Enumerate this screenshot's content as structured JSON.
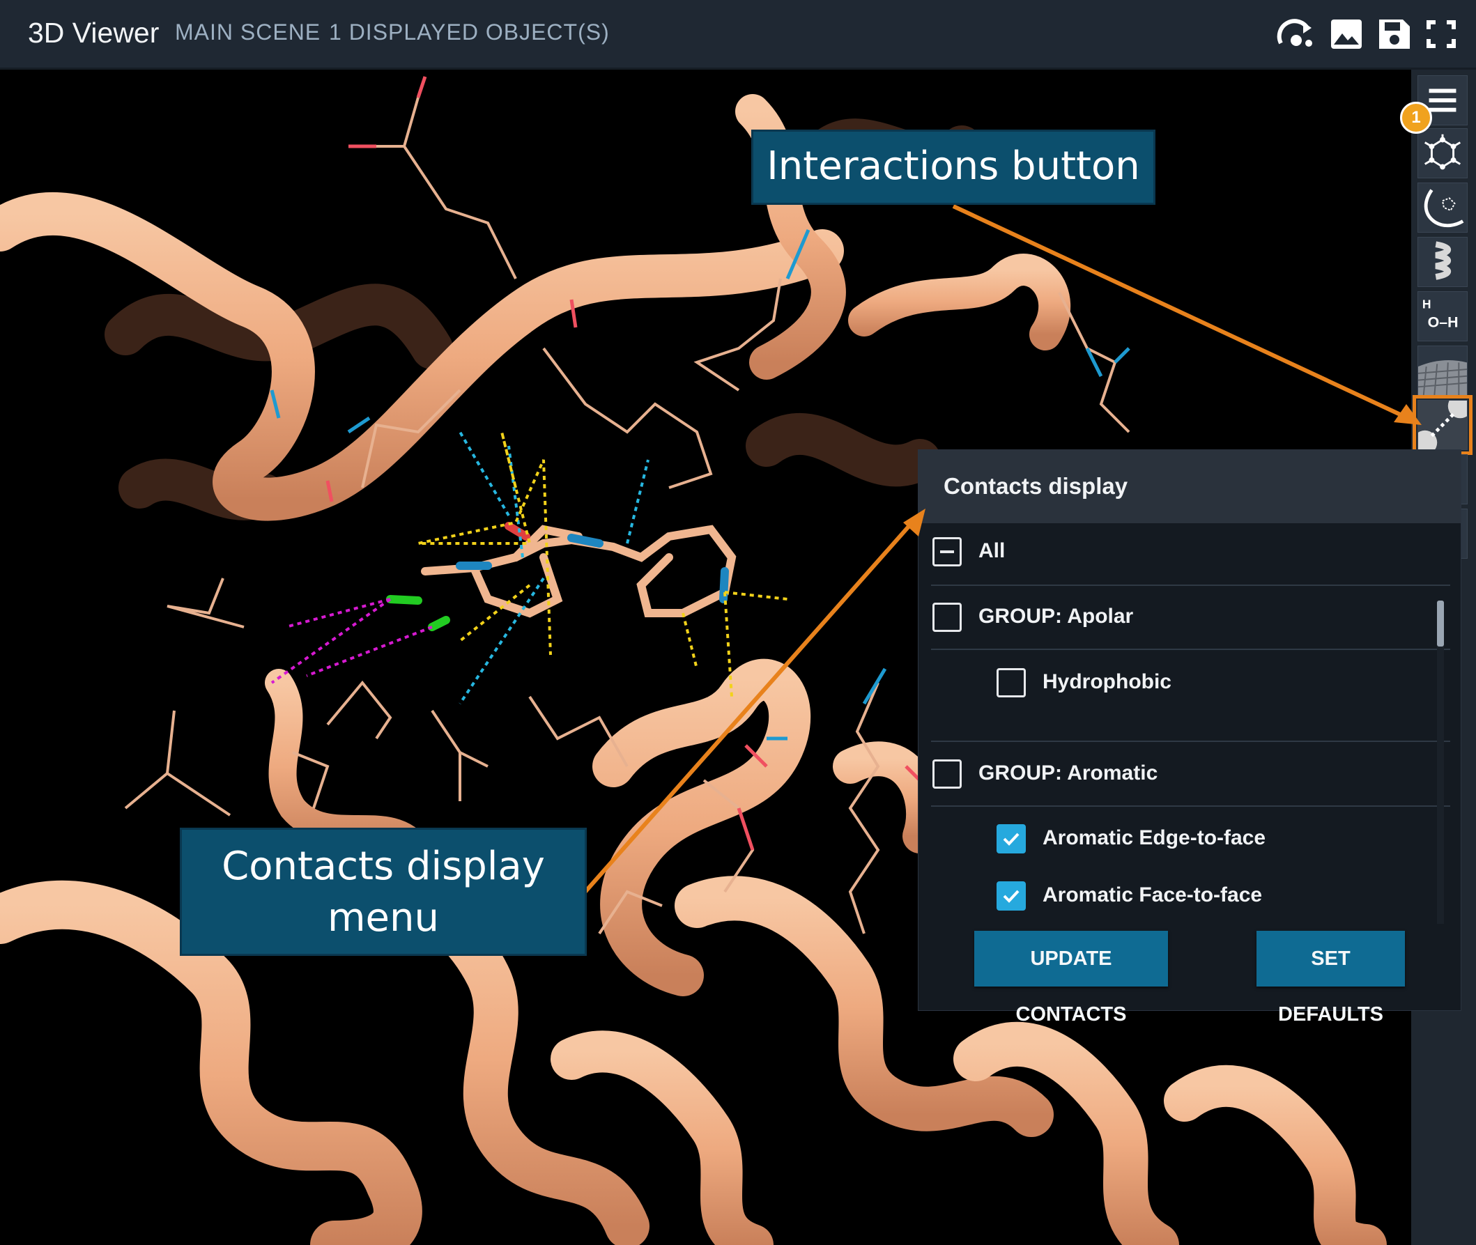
{
  "header": {
    "title": "3D Viewer",
    "scene": "MAIN SCENE",
    "objects": "1 DISPLAYED OBJECT(S)",
    "buttons": [
      {
        "icon": "orbit-icon"
      },
      {
        "icon": "image-icon"
      },
      {
        "icon": "save-icon"
      },
      {
        "icon": "fullscreen-icon"
      }
    ]
  },
  "toolbar": {
    "badge": "1",
    "buttons": [
      {
        "icon": "menu-icon"
      },
      {
        "icon": "molecule-icon"
      },
      {
        "icon": "ligand-pocket-icon"
      },
      {
        "icon": "helix-icon"
      },
      {
        "icon": "hydrogen-icon",
        "text_h": "H",
        "text_oh": "O–H"
      },
      {
        "icon": "surface-icon"
      },
      {
        "icon": "interactions-icon",
        "active": true
      },
      {
        "icon": "settings-icon"
      },
      {
        "icon": "target-icon"
      }
    ]
  },
  "contacts_panel": {
    "title": "Contacts display",
    "options": [
      {
        "label": "All",
        "state": "indeterminate"
      },
      {
        "label": "GROUP: Apolar",
        "state": "unchecked"
      },
      {
        "label": "Hydrophobic",
        "state": "unchecked"
      },
      {
        "label": "GROUP: Aromatic",
        "state": "unchecked"
      },
      {
        "label": "Aromatic Edge-to-face",
        "state": "checked"
      },
      {
        "label": "Aromatic Face-to-face",
        "state": "checked"
      }
    ],
    "update_button": "UPDATE CONTACTS",
    "defaults_button": "SET DEFAULTS"
  },
  "annotations": {
    "interactions": "Interactions button",
    "contacts": "Contacts display\nmenu"
  },
  "colors": {
    "header_bg": "#1f2833",
    "ribbon": "#f2b48c",
    "accent_orange": "#e8821c",
    "checkbox_blue": "#26a9de",
    "button_blue": "#0f6b93",
    "callout_bg": "#0c4f6d",
    "contact_cyan": "#27b7e0",
    "contact_yellow": "#f2d21a",
    "contact_magenta": "#d61ad1",
    "halogen_green": "#22cc22"
  }
}
